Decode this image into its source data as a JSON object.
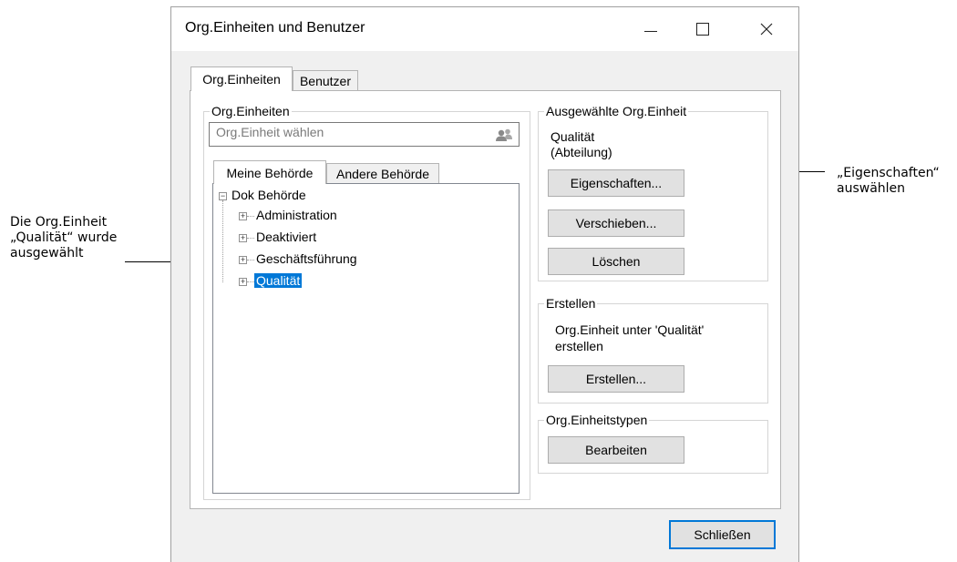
{
  "window": {
    "title": "Org.Einheiten und Benutzer",
    "minimize": "—",
    "maximize": "☐",
    "close": "✕"
  },
  "tabs": [
    {
      "label": "Org.Einheiten",
      "active": true
    },
    {
      "label": "Benutzer",
      "active": false
    }
  ],
  "left_group": {
    "label": "Org.Einheiten",
    "search_placeholder": "Org.Einheit wählen",
    "search_icon": "users-icon",
    "subtabs": [
      {
        "label": "Meine Behörde",
        "active": true
      },
      {
        "label": "Andere Behörde",
        "active": false
      }
    ],
    "tree": {
      "root": "Dok Behörde",
      "root_toggle": "−",
      "children": [
        {
          "label": "Administration",
          "toggle": "+",
          "selected": false
        },
        {
          "label": "Deaktiviert",
          "toggle": "+",
          "selected": false
        },
        {
          "label": "Geschäftsführung",
          "toggle": "+",
          "selected": false
        },
        {
          "label": "Qualität",
          "toggle": "+",
          "selected": true
        }
      ]
    }
  },
  "selected_group": {
    "label": "Ausgewählte Org.Einheit",
    "name": "Qualität",
    "type": "(Abteilung)",
    "buttons": {
      "properties": "Eigenschaften...",
      "move": "Verschieben...",
      "delete": "Löschen"
    }
  },
  "create_group": {
    "label": "Erstellen",
    "text_line1": "Org.Einheit unter 'Qualität'",
    "text_line2": "erstellen",
    "button": "Erstellen..."
  },
  "types_group": {
    "label": "Org.Einheitstypen",
    "button": "Bearbeiten"
  },
  "close_button": "Schließen",
  "annotations": {
    "left_line1": "Die Org.Einheit",
    "left_line2": "„Qualität“ wurde",
    "left_line3": "ausgewählt",
    "right_line1": "„Eigenschaften“",
    "right_line2": "auswählen"
  }
}
